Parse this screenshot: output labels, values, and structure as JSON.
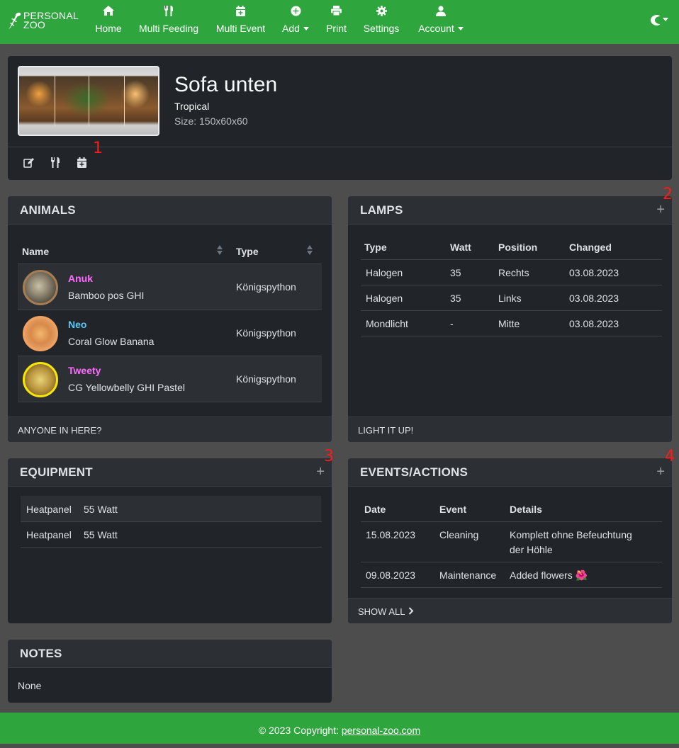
{
  "navbar": {
    "brand_line1": "PERSONAL",
    "brand_line2": "ZOO",
    "items": [
      {
        "label": "Home",
        "icon": "home-icon"
      },
      {
        "label": "Multi Feeding",
        "icon": "utensils-icon"
      },
      {
        "label": "Multi Event",
        "icon": "calendar-plus-icon"
      },
      {
        "label": "Add",
        "icon": "plus-circle-icon",
        "dropdown": true
      },
      {
        "label": "Print",
        "icon": "print-icon"
      },
      {
        "label": "Settings",
        "icon": "gear-icon"
      },
      {
        "label": "Account",
        "icon": "user-icon",
        "dropdown": true
      }
    ],
    "theme_icon": "moon-icon"
  },
  "terrarium": {
    "title": "Sofa unten",
    "type": "Tropical",
    "size": "Size: 150x60x60",
    "actions": [
      "edit-icon",
      "utensils-icon",
      "calendar-plus-icon"
    ]
  },
  "animals": {
    "title": "ANIMALS",
    "columns": [
      "Name",
      "Type"
    ],
    "rows": [
      {
        "name": "Anuk",
        "morph": "Bamboo pos GHI",
        "type": "Königspython",
        "name_color": "#ff6bff",
        "ring_color": "#a67c52"
      },
      {
        "name": "Neo",
        "morph": "Coral Glow Banana",
        "type": "Königspython",
        "name_color": "#5bc8f5",
        "ring_color": "#f0a060"
      },
      {
        "name": "Tweety",
        "morph": "CG Yellowbelly GHI Pastel",
        "type": "Königspython",
        "name_color": "#ff6bff",
        "ring_color": "#f7e600"
      }
    ],
    "footer": "ANYONE IN HERE?"
  },
  "lamps": {
    "title": "LAMPS",
    "add_symbol": "+",
    "columns": [
      "Type",
      "Watt",
      "Position",
      "Changed"
    ],
    "rows": [
      [
        "Halogen",
        "35",
        "Rechts",
        "03.08.2023"
      ],
      [
        "Halogen",
        "35",
        "Links",
        "03.08.2023"
      ],
      [
        "Mondlicht",
        "-",
        "Mitte",
        "03.08.2023"
      ]
    ],
    "footer": "LIGHT IT UP!"
  },
  "equipment": {
    "title": "EQUIPMENT",
    "add_symbol": "+",
    "rows": [
      [
        "Heatpanel",
        "55 Watt"
      ],
      [
        "Heatpanel",
        "55 Watt"
      ]
    ]
  },
  "events": {
    "title": "EVENTS/ACTIONS",
    "add_symbol": "+",
    "columns": [
      "Date",
      "Event",
      "Details"
    ],
    "rows": [
      {
        "date": "15.08.2023",
        "event": "Cleaning",
        "details_line1": "Komplett ohne Befeuchtung",
        "details_line2": "der Höhle"
      },
      {
        "date": "09.08.2023",
        "event": "Maintenance",
        "details_line1": "Added flowers 🌺",
        "details_line2": ""
      }
    ],
    "footer": "SHOW ALL"
  },
  "notes": {
    "title": "NOTES",
    "text": "None"
  },
  "footer": {
    "prefix": "© 2023 Copyright: ",
    "link": "personal-zoo.com"
  },
  "markers": [
    "1",
    "2",
    "3",
    "4"
  ],
  "colors": {
    "navbar": "#2fa53e",
    "background": "#4d4d4d",
    "card": "#212529",
    "marker": "#ff1a1a"
  }
}
